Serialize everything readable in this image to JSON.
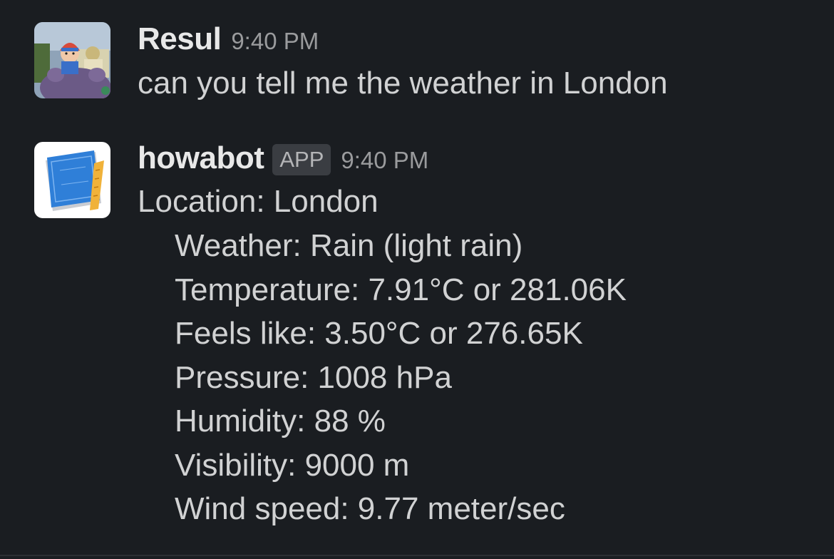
{
  "messages": [
    {
      "sender": "Resul",
      "time": "9:40 PM",
      "text": "can you tell me the weather in London",
      "avatar": "user-photo-avatar"
    },
    {
      "sender": "howabot",
      "badge": "APP",
      "time": "9:40 PM",
      "avatar": "blueprint-ruler-icon",
      "location_line": "Location: London",
      "details": [
        "Weather: Rain (light rain)",
        "Temperature: 7.91°C or 281.06K",
        "Feels like: 3.50°C or 276.65K",
        "Pressure: 1008 hPa",
        "Humidity: 88 %",
        "Visibility: 9000 m",
        "Wind speed: 9.77 meter/sec"
      ]
    }
  ],
  "colors": {
    "background": "#1a1d21",
    "text": "#d1d2d3",
    "timestamp": "#9a9b9d",
    "badge_bg": "#3a3d42"
  }
}
